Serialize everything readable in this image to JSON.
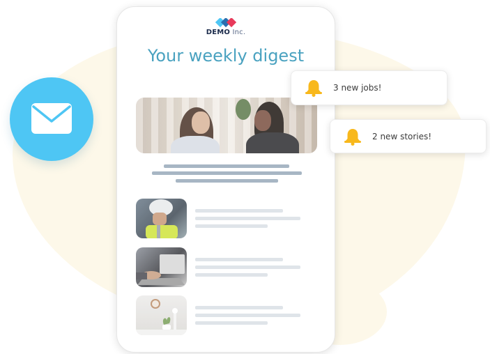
{
  "brand": {
    "logo_bold": "DEMO",
    "logo_light": "Inc."
  },
  "email": {
    "title": "Your weekly digest"
  },
  "notifications": [
    {
      "label": "3 new jobs!"
    },
    {
      "label": "2 new stories!"
    }
  ],
  "colors": {
    "accent_title": "#4aa2c0",
    "mail_circle": "#4ec6f4",
    "bell": "#f8b81c",
    "blob": "#fdf8e9"
  },
  "icons": [
    "envelope-icon",
    "bell-icon",
    "demo-logo"
  ]
}
